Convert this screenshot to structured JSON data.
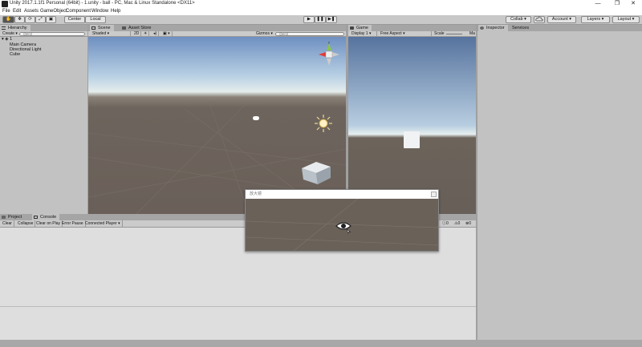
{
  "window": {
    "title": "Unity 2017.1.1f1 Personal (64bit) - 1.unity - ball - PC, Mac & Linux Standalone <DX11>",
    "controls": [
      "—",
      "❐",
      "✕"
    ]
  },
  "menu": [
    "File",
    "Edit",
    "Assets",
    "GameObject",
    "Component",
    "Window",
    "Help"
  ],
  "toolbar": {
    "tools": [
      "✋",
      "✥",
      "⟳",
      "⤢",
      "▣"
    ],
    "pivot": "Center",
    "space": "Local",
    "play": [
      "▶",
      "❚❚",
      "▶❚"
    ],
    "collab": "Collab ▾",
    "cloud_icon": "cloud-icon",
    "account": "Account",
    "layers": "Layers",
    "layout": "Layout"
  },
  "hierarchy": {
    "tab": "Hierarchy",
    "create": "Create ▾",
    "search_placeholder": "Q▾All",
    "scene_name": "1",
    "items": [
      "Main Camera",
      "Directional Light",
      "Cube"
    ]
  },
  "scene": {
    "tab": "Scene",
    "asset_tab": "Asset Store",
    "shading": "Shaded",
    "mode_2d": "2D",
    "gizmos": "Gizmos ▾",
    "search_placeholder": "Q▾All"
  },
  "game": {
    "tab": "Game",
    "display": "Display 1",
    "aspect": "Free Aspect",
    "scale": "Scale",
    "maximize": "Ma"
  },
  "inspector": {
    "tab": "Inspector",
    "services_tab": "Services"
  },
  "console": {
    "project_tab": "Project",
    "tab": "Console",
    "buttons": [
      "Clear",
      "Collapse",
      "Clear on Play",
      "Error Pause",
      "Connected Player ▾"
    ],
    "counts": [
      "0",
      "0",
      "0"
    ]
  },
  "magnifier": {
    "title": "放大镜"
  }
}
